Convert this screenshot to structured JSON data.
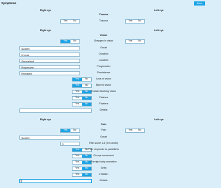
{
  "header": {
    "title": "Symptoms",
    "done_label": "Done"
  },
  "trauma": {
    "right_header": "Right eye",
    "left_header": "Left eye",
    "title": "Trauma",
    "row_label": "Trauma",
    "right_yes": "Yes",
    "right_no": "No",
    "left_yes": "Yes",
    "left_no": "No"
  },
  "vision": {
    "right_header": "Right eye",
    "left_header": "Left eye",
    "title": "Vision",
    "changes": {
      "label": "Changes in vision",
      "right_yes": "Yes",
      "right_no": "No",
      "left_yes": "Yes",
      "left_no": "No"
    },
    "onset": {
      "label": "Onset",
      "value": "Sudden"
    },
    "duration": {
      "label": "Duration",
      "value": "6 hours"
    },
    "location": {
      "label": "Location",
      "value": "Generalised"
    },
    "progression": {
      "label": "Progression",
      "value": "Progressive"
    },
    "persistence": {
      "label": "Persistence",
      "value": "Persistent"
    },
    "loss": {
      "label": "Loss of vision",
      "yes": "Yes",
      "no": "No"
    },
    "blurred": {
      "label": "Blurred vision",
      "yes": "Yes",
      "no": "No"
    },
    "curtain": {
      "label": "Curtain blocking vision",
      "yes": "Yes",
      "no": "No"
    },
    "flashes": {
      "label": "Flashes",
      "yes": "Yes",
      "no": "No"
    },
    "floaters": {
      "label": "Floaters",
      "yes": "Yes",
      "no": "No"
    },
    "details": {
      "label": "Details",
      "value": ""
    }
  },
  "pain": {
    "right_header": "Right eye",
    "left_header": "Left eye",
    "title": "Pain",
    "pain_row": {
      "label": "Pain",
      "right_yes": "Yes",
      "right_no": "No",
      "left_yes": "Yes",
      "left_no": "No"
    },
    "onset": {
      "label": "Onset",
      "value": "Sudden"
    },
    "score": {
      "label": "Pain score 1-5 (5 is worst)",
      "value": "3"
    },
    "painkillers": {
      "label": "Pain responds to painkillers",
      "yes": "Yes",
      "no": "No"
    },
    "eye_movement": {
      "label": "On eye movement",
      "yes": "Yes",
      "no": "No"
    },
    "foreign_body": {
      "label": "Foreign body sensation",
      "yes": "Yes",
      "no": "No"
    },
    "gritty": {
      "label": "Gritty",
      "yes": "Yes",
      "no": "No"
    },
    "irritation": {
      "label": "Irritation",
      "yes": "Yes",
      "no": "No"
    },
    "details": {
      "label": "Details",
      "value": ""
    }
  },
  "colors": {
    "accent": "#1aa3e6",
    "background": "#d9eef9"
  }
}
